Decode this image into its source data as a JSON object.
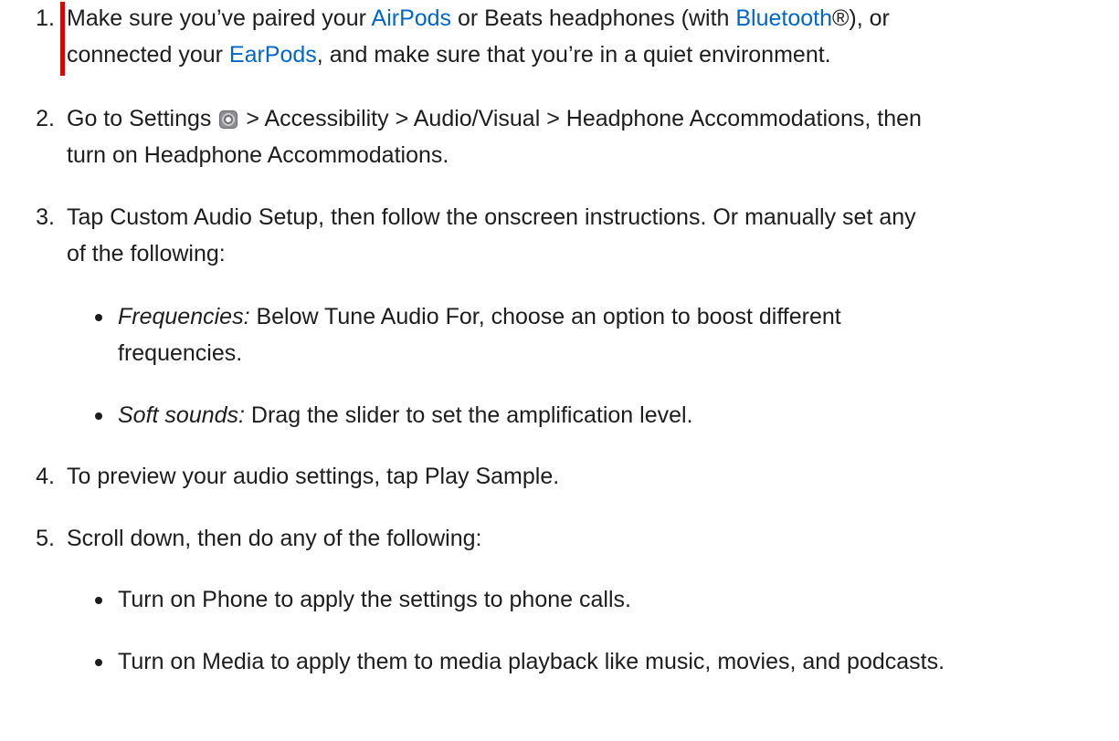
{
  "steps": [
    {
      "number": "1.",
      "line1": {
        "a": "Make sure you’ve paired your ",
        "link1": "AirPods",
        "b": " or Beats headphones (with ",
        "link2": "Bluetooth",
        "c": "®), or"
      },
      "line2": {
        "a": "connected your ",
        "link": "EarPods",
        "b": ", and make sure that you’re in a quiet environment."
      }
    },
    {
      "number": "2.",
      "line1": {
        "a": "Go to Settings ",
        "icon": "settings-gear-icon",
        "b": " > Accessibility > Audio/Visual > Headphone Accommodations, then"
      },
      "line2": "turn on Headphone Accommodations."
    },
    {
      "number": "3.",
      "line1": "Tap Custom Audio Setup, then follow the onscreen instructions. Or manually set any",
      "line2": "of the following:",
      "bullets": [
        {
          "term": "Frequencies:",
          "line1": " Below Tune Audio For, choose an option to boost different",
          "line2": "frequencies."
        },
        {
          "term": "Soft sounds:",
          "line1": " Drag the slider to set the amplification level."
        }
      ]
    },
    {
      "number": "4.",
      "line1": "To preview your audio settings, tap Play Sample."
    },
    {
      "number": "5.",
      "line1": "Scroll down, then do any of the following:",
      "bullets": [
        {
          "line1": "Turn on Phone to apply the settings to phone calls."
        },
        {
          "line1": "Turn on Media to apply them to media playback like music, movies, and podcasts."
        }
      ]
    }
  ],
  "colors": {
    "text": "#1d1d1f",
    "link": "#0066cc",
    "highlight_bar": "#e10000"
  }
}
